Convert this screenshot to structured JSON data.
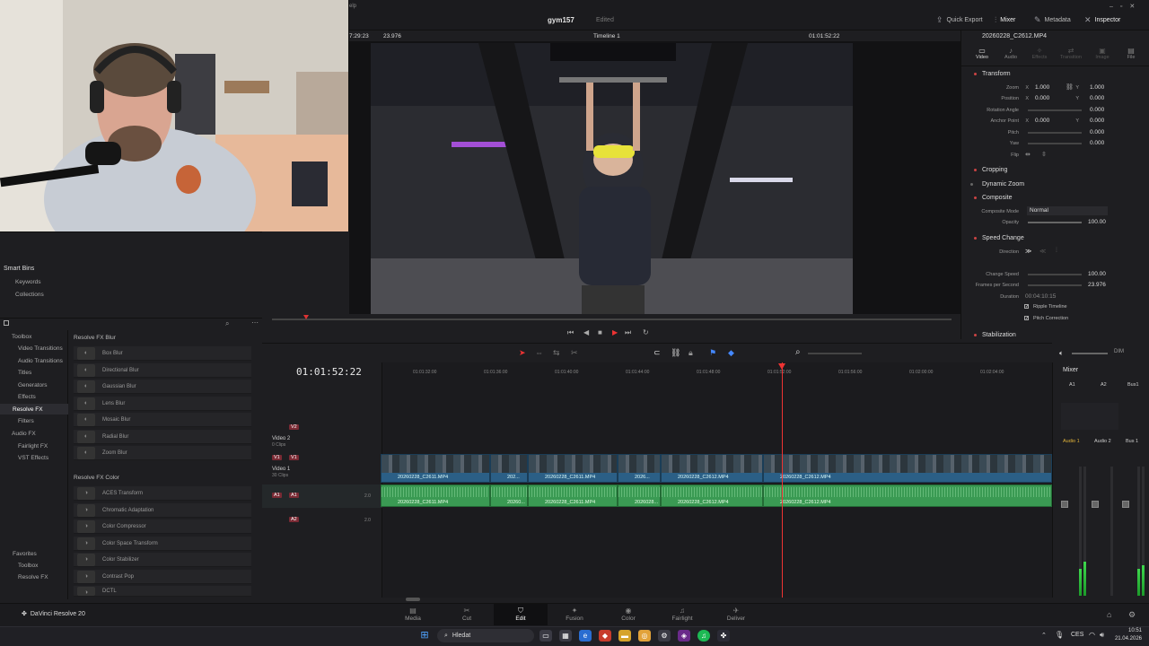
{
  "window": {
    "project_name": "gym157",
    "status": "Edited",
    "top_buttons": [
      "Quick Export",
      "Mixer",
      "Metadata",
      "Inspector"
    ],
    "menu_fragment": "elp"
  },
  "viewer": {
    "timecode_left": "7:29:23",
    "fps": "23.976",
    "timeline_name": "Timeline 1",
    "timecode_right": "01:01:52:22"
  },
  "inspector": {
    "clip_name": "20260228_C2612.MP4",
    "tabs": [
      "Video",
      "Audio",
      "Effects",
      "Transition",
      "Image",
      "File"
    ],
    "sections": {
      "transform": "Transform",
      "cropping": "Cropping",
      "dynamic_zoom": "Dynamic Zoom",
      "composite": "Composite",
      "speed_change": "Speed Change",
      "stabilization": "Stabilization"
    },
    "fields": {
      "zoom_label": "Zoom",
      "zoom_x": "1.000",
      "zoom_y": "1.000",
      "position_label": "Position",
      "position_x": "0.000",
      "position_y": "0.000",
      "rotation_label": "Rotation Angle",
      "rotation": "0.000",
      "anchor_label": "Anchor Point",
      "anchor_x": "0.000",
      "anchor_y": "0.000",
      "pitch_label": "Pitch",
      "pitch": "0.000",
      "yaw_label": "Yaw",
      "yaw": "0.000",
      "flip_label": "Flip",
      "composite_mode_label": "Composite Mode",
      "composite_mode": "Normal",
      "opacity_label": "Opacity",
      "opacity": "100.00",
      "direction_label": "Direction",
      "change_speed_label": "Change Speed",
      "change_speed": "100.00",
      "fps_label": "Frames per Second",
      "fps_value": "23.976",
      "duration_label": "Duration",
      "duration": "00:04:10:15",
      "ripple_label": "Ripple Timeline",
      "pitch_corr_label": "Pitch Correction",
      "x_label": "X",
      "y_label": "Y"
    }
  },
  "smart_bins": {
    "title": "Smart Bins",
    "items": [
      "Keywords",
      "Collections"
    ]
  },
  "effects_tree": {
    "toolbox": "Toolbox",
    "video_transitions": "Video Transitions",
    "audio_transitions": "Audio Transitions",
    "titles": "Titles",
    "generators": "Generators",
    "effects": "Effects",
    "resolve_fx": "Resolve FX",
    "filters": "Filters",
    "audio_fx": "Audio FX",
    "fairlight_fx": "Fairlight FX",
    "vst_effects": "VST Effects",
    "favorites": "Favorites",
    "fav_toolbox": "Toolbox",
    "fav_resolve_fx": "Resolve FX"
  },
  "effects_list": {
    "blur_header": "Resolve FX Blur",
    "blur_items": [
      "Box Blur",
      "Directional Blur",
      "Gaussian Blur",
      "Lens Blur",
      "Mosaic Blur",
      "Radial Blur",
      "Zoom Blur"
    ],
    "color_header": "Resolve FX Color",
    "color_items": [
      "ACES Transform",
      "Chromatic Adaptation",
      "Color Compressor",
      "Color Space Transform",
      "Color Stabilizer",
      "Contrast Pop",
      "DCTL"
    ]
  },
  "timeline": {
    "timecode": "01:01:52:22",
    "ruler": [
      "01:01:32:00",
      "01:01:36:00",
      "01:01:40:00",
      "01:01:44:00",
      "01:01:48:00",
      "01:01:52:00",
      "01:01:56:00",
      "01:02:00:00",
      "01:02:04:00"
    ],
    "tracks": {
      "v2": "V2",
      "v2_name": "Video 2",
      "v2_clips": "0 Clips",
      "v1": "V1",
      "v1_name": "Video 1",
      "v1_clips": "30 Clips",
      "a1": "A1",
      "a1_level": "2.0",
      "a2": "A2",
      "a2_level": "2.0"
    },
    "video_clips": [
      "20260228_C2611.MP4",
      "202...",
      "20260228_C2611.MP4",
      "2026...",
      "20260228_C2612.MP4",
      "20260228_C2612.MP4"
    ],
    "audio_clips": [
      "20260228_C2611.MP4",
      "20260...",
      "20260228_C2611.MP4",
      "2026028...",
      "20260228_C2612.MP4",
      "20260228_C2612.MP4"
    ]
  },
  "mixer": {
    "title": "Mixer",
    "channels": [
      "A1",
      "A2",
      "Bus1"
    ],
    "channel_names": [
      "Audio 1",
      "Audio 2",
      "Bus 1"
    ],
    "dim_label": "DIM"
  },
  "pages": [
    "Media",
    "Cut",
    "Edit",
    "Fusion",
    "Color",
    "Fairlight",
    "Deliver"
  ],
  "active_page": "Edit",
  "app_name": "DaVinci Resolve 20",
  "taskbar": {
    "search_placeholder": "Hledat",
    "language": "CES",
    "time": "10:51",
    "date": "21.04.2026"
  },
  "colors": {
    "video_clip": "#2b5f86",
    "audio_clip": "#3a9a53",
    "playhead": "#e33333",
    "accent_red": "#c44444"
  }
}
